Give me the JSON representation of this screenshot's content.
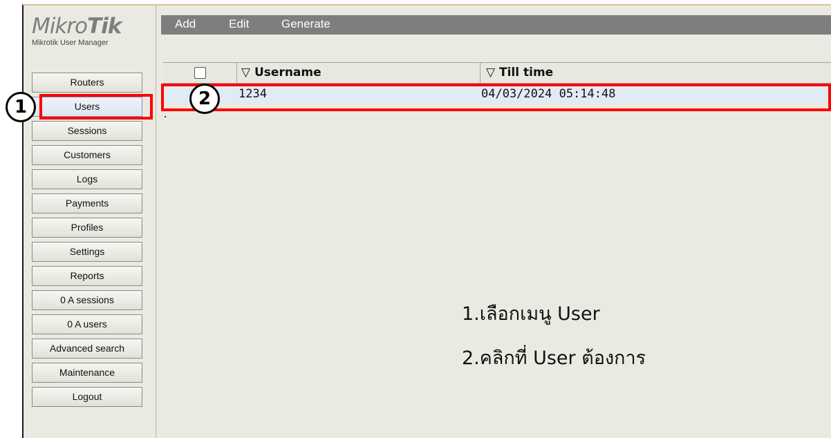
{
  "logo": {
    "brand_light": "Mikro",
    "brand_bold": "Tik",
    "subtitle": "Mikrotik User Manager"
  },
  "sidebar": {
    "items": [
      {
        "label": "Routers"
      },
      {
        "label": "Users",
        "active": true
      },
      {
        "label": "Sessions"
      },
      {
        "label": "Customers"
      },
      {
        "label": "Logs"
      },
      {
        "label": "Payments"
      },
      {
        "label": "Profiles"
      },
      {
        "label": "Settings"
      },
      {
        "label": "Reports"
      },
      {
        "label": "0 A sessions"
      },
      {
        "label": "0 A users"
      },
      {
        "label": "Advanced search"
      },
      {
        "label": "Maintenance"
      },
      {
        "label": "Logout"
      }
    ]
  },
  "toolbar": {
    "add": "Add",
    "edit": "Edit",
    "generate": "Generate"
  },
  "table": {
    "columns": [
      "▽ Username",
      "▽ Till time"
    ],
    "rows": [
      {
        "username": "1234",
        "till_time": "04/03/2024 05:14:48"
      }
    ]
  },
  "annotations": {
    "badge_1": "1",
    "badge_2": "2",
    "note_line_1": "1.เลือกเมนู User",
    "note_line_2": "2.คลิกที่ User ต้องการ",
    "highlight_color": "#ff0000"
  },
  "colors": {
    "toolbar_bg": "#7e7e7e",
    "panel_bg": "#ebeae2",
    "selected_row": "#e1ebf6"
  }
}
